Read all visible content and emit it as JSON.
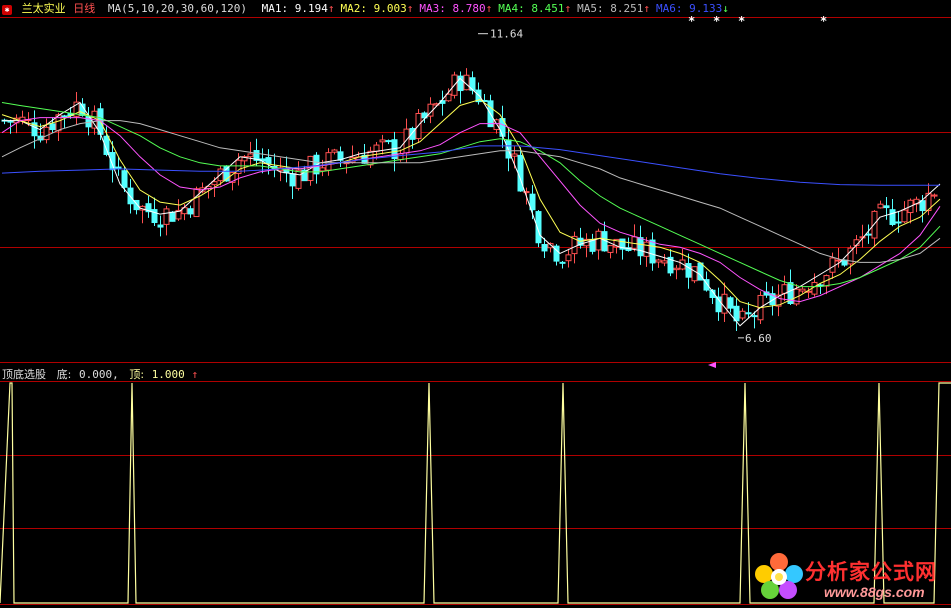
{
  "colors": {
    "up": "#ff5050",
    "down": "#54ffff",
    "border": "#b00000",
    "ma1": "#ffffff",
    "ma2": "#ffff54",
    "ma3": "#ff54ff",
    "ma4": "#54ff54",
    "ma5": "#bbbbbb",
    "ma6": "#3b50ff",
    "signal": "#ffffa0"
  },
  "header": {
    "logo_icon": "stock-app-icon",
    "stock_name": "兰太实业",
    "period": "日线",
    "ma_params": "MA(5,10,20,30,60,120)",
    "ma": [
      {
        "label": "MA1:",
        "value": "9.194",
        "arrow": "↑"
      },
      {
        "label": "MA2:",
        "value": "9.003",
        "arrow": "↑"
      },
      {
        "label": "MA3:",
        "value": "8.780",
        "arrow": "↑"
      },
      {
        "label": "MA4:",
        "value": "8.451",
        "arrow": "↑"
      },
      {
        "label": "MA5:",
        "value": "8.251",
        "arrow": "↑"
      },
      {
        "label": "MA6:",
        "value": "9.133",
        "arrow": "↓"
      }
    ]
  },
  "indicator": {
    "name": "顶底选股",
    "bottom_label": "底:",
    "bottom_value": "0.000,",
    "top_label": "顶:",
    "top_value": "1.000",
    "top_arrow": "↑"
  },
  "watermark": {
    "text": "分析家公式网",
    "url": "www.88gs.com"
  },
  "chart_data": [
    {
      "type": "candlestick",
      "title": "兰太实业 日线",
      "ylim": [
        6.2,
        11.9
      ],
      "high_marker": "11.64",
      "low_marker": "6.60",
      "annotation_star": "*",
      "series": [
        {
          "name": "MA1",
          "x": [
            2,
            20,
            40,
            60,
            80,
            100,
            120,
            140,
            160,
            180,
            200,
            220,
            240,
            260,
            280,
            300,
            320,
            340,
            360,
            380,
            400,
            420,
            440,
            460,
            480,
            500,
            520,
            540,
            560,
            580,
            600,
            620,
            640,
            660,
            680,
            700,
            720,
            740,
            760,
            780,
            800,
            820,
            840,
            860,
            880,
            900,
            920,
            940
          ],
          "y": [
            10.2,
            10.2,
            10.05,
            10.3,
            10.5,
            10.0,
            9.15,
            8.75,
            8.65,
            8.7,
            9.0,
            9.3,
            9.6,
            9.55,
            9.35,
            9.3,
            9.5,
            9.55,
            9.65,
            9.7,
            9.75,
            10.15,
            10.5,
            10.9,
            10.6,
            10.05,
            9.25,
            8.3,
            8.0,
            8.15,
            8.25,
            8.1,
            8.05,
            7.95,
            7.85,
            7.65,
            7.2,
            6.8,
            7.1,
            7.3,
            7.45,
            7.65,
            7.85,
            8.2,
            8.6,
            8.7,
            8.85,
            9.15
          ]
        },
        {
          "name": "MA2",
          "x": [
            2,
            20,
            40,
            60,
            80,
            100,
            120,
            140,
            160,
            180,
            200,
            220,
            240,
            260,
            280,
            300,
            320,
            340,
            360,
            380,
            400,
            420,
            440,
            460,
            480,
            500,
            520,
            540,
            560,
            580,
            600,
            620,
            640,
            660,
            680,
            700,
            720,
            740,
            760,
            780,
            800,
            820,
            840,
            860,
            880,
            900,
            920,
            940
          ],
          "y": [
            10.3,
            10.2,
            10.1,
            10.2,
            10.35,
            10.2,
            9.55,
            9.05,
            8.85,
            8.8,
            8.95,
            9.15,
            9.4,
            9.5,
            9.45,
            9.4,
            9.45,
            9.5,
            9.6,
            9.65,
            9.7,
            9.85,
            10.15,
            10.45,
            10.55,
            10.3,
            9.75,
            8.9,
            8.35,
            8.2,
            8.25,
            8.2,
            8.15,
            8.1,
            8.0,
            7.85,
            7.55,
            7.2,
            7.1,
            7.15,
            7.3,
            7.5,
            7.65,
            7.9,
            8.2,
            8.45,
            8.6,
            8.9
          ]
        },
        {
          "name": "MA3",
          "x": [
            2,
            20,
            40,
            60,
            80,
            100,
            120,
            140,
            160,
            180,
            200,
            220,
            240,
            260,
            280,
            300,
            320,
            340,
            360,
            380,
            400,
            420,
            440,
            460,
            480,
            500,
            520,
            540,
            560,
            580,
            600,
            620,
            640,
            660,
            680,
            700,
            720,
            740,
            760,
            780,
            800,
            820,
            840,
            860,
            880,
            900,
            920,
            940
          ],
          "y": [
            10.0,
            10.2,
            10.25,
            10.25,
            10.25,
            10.2,
            9.95,
            9.6,
            9.3,
            9.1,
            9.05,
            9.1,
            9.25,
            9.35,
            9.4,
            9.4,
            9.45,
            9.5,
            9.55,
            9.6,
            9.65,
            9.7,
            9.8,
            10.0,
            10.15,
            10.15,
            10.0,
            9.6,
            9.2,
            8.8,
            8.5,
            8.35,
            8.25,
            8.15,
            8.1,
            8.0,
            7.85,
            7.6,
            7.4,
            7.25,
            7.2,
            7.3,
            7.45,
            7.6,
            7.8,
            8.0,
            8.3,
            8.78
          ]
        },
        {
          "name": "MA4",
          "x": [
            2,
            20,
            40,
            60,
            80,
            100,
            120,
            140,
            160,
            180,
            200,
            220,
            240,
            260,
            280,
            300,
            320,
            340,
            360,
            380,
            400,
            420,
            440,
            460,
            480,
            500,
            520,
            540,
            560,
            580,
            600,
            620,
            640,
            660,
            680,
            700,
            720,
            740,
            760,
            780,
            800,
            820,
            840,
            860,
            880,
            900,
            920,
            940
          ],
          "y": [
            10.5,
            10.45,
            10.4,
            10.35,
            10.3,
            10.25,
            10.1,
            9.95,
            9.75,
            9.6,
            9.5,
            9.45,
            9.45,
            9.45,
            9.4,
            9.35,
            9.35,
            9.4,
            9.45,
            9.5,
            9.55,
            9.6,
            9.65,
            9.75,
            9.85,
            9.9,
            9.85,
            9.7,
            9.5,
            9.2,
            8.95,
            8.75,
            8.6,
            8.45,
            8.3,
            8.15,
            8.0,
            7.85,
            7.7,
            7.55,
            7.45,
            7.45,
            7.5,
            7.6,
            7.75,
            7.9,
            8.1,
            8.45
          ]
        },
        {
          "name": "MA5",
          "x": [
            2,
            20,
            40,
            60,
            80,
            100,
            120,
            140,
            160,
            180,
            200,
            220,
            240,
            260,
            280,
            300,
            320,
            340,
            360,
            380,
            400,
            420,
            440,
            460,
            480,
            500,
            520,
            540,
            560,
            580,
            600,
            620,
            640,
            660,
            680,
            700,
            720,
            740,
            760,
            780,
            800,
            820,
            840,
            860,
            880,
            900,
            920,
            940
          ],
          "y": [
            9.6,
            9.75,
            9.9,
            10.05,
            10.15,
            10.2,
            10.2,
            10.15,
            10.05,
            9.95,
            9.85,
            9.75,
            9.7,
            9.65,
            9.6,
            9.55,
            9.5,
            9.5,
            9.5,
            9.5,
            9.5,
            9.5,
            9.55,
            9.6,
            9.65,
            9.7,
            9.7,
            9.65,
            9.6,
            9.5,
            9.4,
            9.25,
            9.15,
            9.05,
            8.95,
            8.85,
            8.75,
            8.6,
            8.45,
            8.3,
            8.15,
            8.0,
            7.9,
            7.85,
            7.85,
            7.9,
            8.0,
            8.25
          ]
        },
        {
          "name": "MA6",
          "x": [
            2,
            40,
            80,
            120,
            160,
            200,
            240,
            280,
            320,
            360,
            400,
            440,
            480,
            520,
            560,
            600,
            640,
            680,
            720,
            760,
            800,
            840,
            880,
            920,
            940
          ],
          "y": [
            9.33,
            9.36,
            9.38,
            9.4,
            9.38,
            9.36,
            9.36,
            9.4,
            9.46,
            9.55,
            9.62,
            9.68,
            9.78,
            9.78,
            9.72,
            9.62,
            9.52,
            9.42,
            9.32,
            9.24,
            9.18,
            9.14,
            9.13,
            9.13,
            9.13
          ]
        }
      ]
    },
    {
      "type": "line",
      "title": "顶底选股",
      "ylim": [
        0,
        1
      ],
      "series": [
        {
          "name": "底",
          "value": 0.0
        },
        {
          "name": "顶",
          "value": 1.0
        }
      ],
      "x": [
        0,
        10,
        12,
        14,
        128,
        132,
        136,
        424,
        429,
        434,
        558,
        563,
        568,
        740,
        745,
        750,
        874,
        879,
        884,
        934,
        939,
        944,
        951
      ],
      "y": [
        0,
        1,
        1,
        0,
        0,
        1,
        0,
        0,
        1,
        0,
        0,
        1,
        0,
        0,
        1,
        0,
        0,
        1,
        0,
        0,
        1,
        1,
        1
      ]
    }
  ]
}
